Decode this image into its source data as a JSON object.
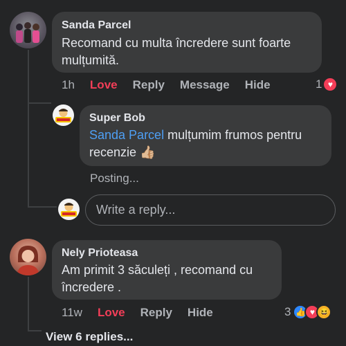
{
  "comments": [
    {
      "author": "Sanda Parcel",
      "text": "Recomand cu multa încredere sunt foarte mulțumită.",
      "time": "1h",
      "actions": [
        "Love",
        "Reply",
        "Message",
        "Hide"
      ],
      "reaction_count": "1"
    },
    {
      "author": "Super Bob",
      "mention": "Sanda Parcel",
      "text": " mulțumim frumos pentru recenzie 👍🏼",
      "status": "Posting..."
    },
    {
      "author": "Nely Prioteasa",
      "text": "Am primit 3 săculeți , recomand cu încredere .",
      "time": "11w",
      "actions": [
        "Love",
        "Reply",
        "Hide"
      ],
      "reaction_count": "3"
    }
  ],
  "reply_box": {
    "placeholder": "Write a reply..."
  },
  "view_replies": "View 6 replies...",
  "icons": {
    "heart": "heart-reaction-icon",
    "like": "like-reaction-icon",
    "haha": "haha-reaction-icon",
    "thumbs": "thumbs-up-emoji"
  },
  "colors": {
    "background": "#242526",
    "bubble": "#3a3b3c",
    "love": "#f33e58",
    "mention": "#4e9ff5",
    "muted": "#b0b3b8"
  }
}
